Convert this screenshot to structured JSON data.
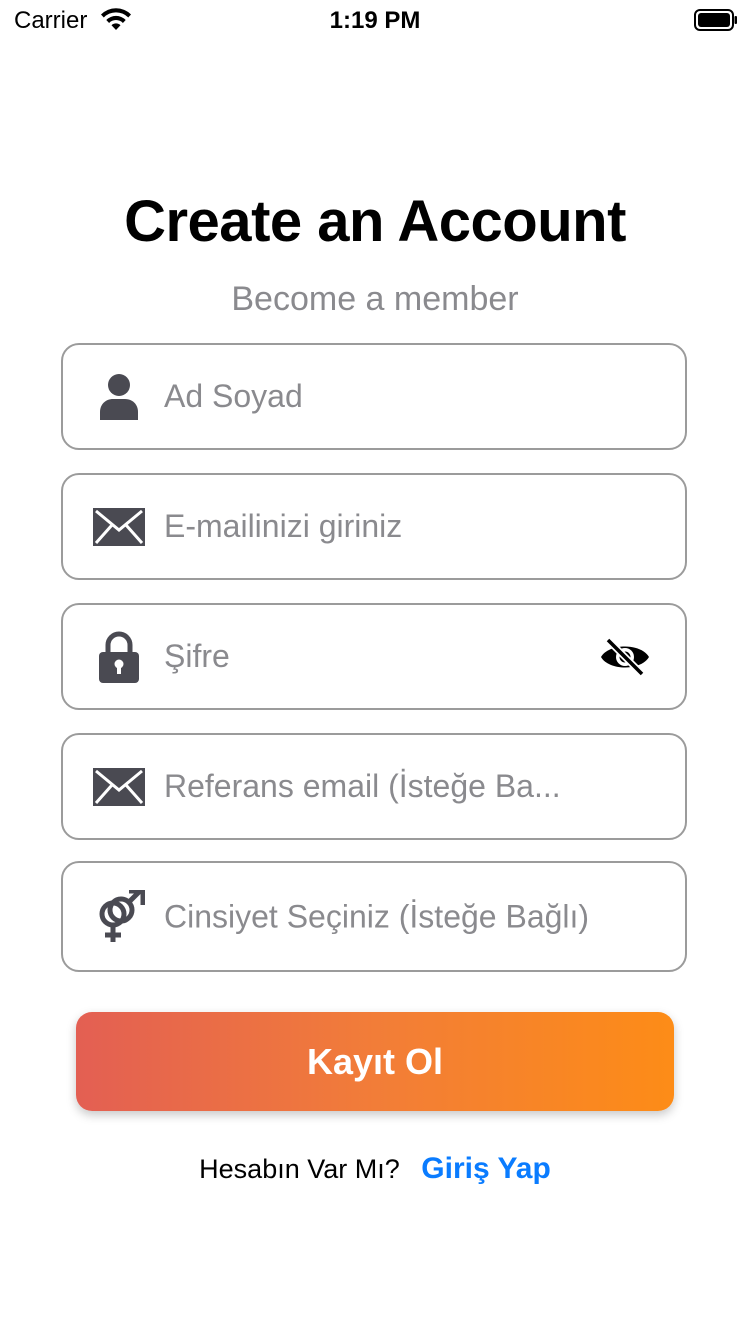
{
  "status_bar": {
    "carrier": "Carrier",
    "time": "1:19 PM"
  },
  "header": {
    "title": "Create an Account",
    "subtitle": "Become a member"
  },
  "form": {
    "name": {
      "placeholder": "Ad Soyad",
      "icon": "person-icon"
    },
    "email": {
      "placeholder": "E-mailinizi giriniz",
      "icon": "envelope-icon"
    },
    "password": {
      "placeholder": "Şifre",
      "icon": "lock-icon",
      "toggle_icon": "eye-slash-icon"
    },
    "referral": {
      "placeholder": "Referans email (İsteğe Ba...",
      "icon": "envelope-icon"
    },
    "gender": {
      "placeholder": "Cinsiyet Seçiniz (İsteğe Bağlı)",
      "icon": "gender-icon"
    }
  },
  "register_button": {
    "label": "Kayıt Ol"
  },
  "footer": {
    "question": "Hesabın Var Mı?",
    "login_link": "Giriş Yap"
  },
  "colors": {
    "gradient_start": "#e35f53",
    "gradient_end": "#fd8c17",
    "link": "#0a7cff",
    "placeholder": "#8a8a8e",
    "field_border": "#9b9b9b",
    "icon": "#4a4a52"
  }
}
